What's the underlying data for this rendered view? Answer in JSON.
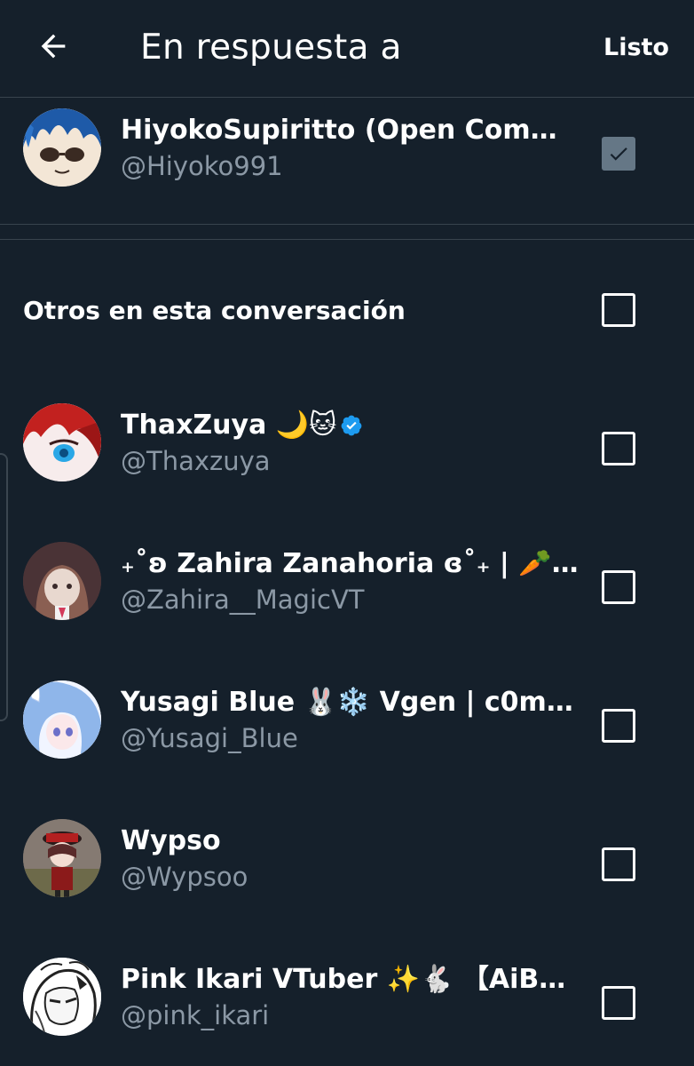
{
  "header": {
    "title": "En respuesta a",
    "done_label": "Listo",
    "back_icon": "arrow-left-icon"
  },
  "replying_to": {
    "name": "HiyokoSupiritto (Open Comms...",
    "handle": "@Hiyoko991",
    "checked": true
  },
  "others": {
    "label": "Otros en esta conversación",
    "checked": false,
    "users": [
      {
        "name": "ThaxZuya 🌙🐱",
        "handle": "@Thaxzuya",
        "verified": true,
        "checked": false
      },
      {
        "name": "₊˚ʚ Zahira Zanahoria ɞ˚₊ | 🥕🎨",
        "handle": "@Zahira__MagicVT",
        "verified": false,
        "checked": false
      },
      {
        "name": "Yusagi Blue 🐰❄️ Vgen | c0m1s ...",
        "handle": "@Yusagi_Blue",
        "verified": false,
        "checked": false
      },
      {
        "name": "Wypso",
        "handle": "@Wypsoo",
        "verified": false,
        "checked": false
      },
      {
        "name": "Pink Ikari VTuber ✨🐇 【AiByt...",
        "handle": "@pink_ikari",
        "verified": false,
        "checked": false
      }
    ]
  },
  "colors": {
    "background": "#15202b",
    "divider": "#38444d",
    "handle_text": "#8b98a5",
    "verified_badge": "#1d9bf0",
    "checked_box": "#657786"
  }
}
